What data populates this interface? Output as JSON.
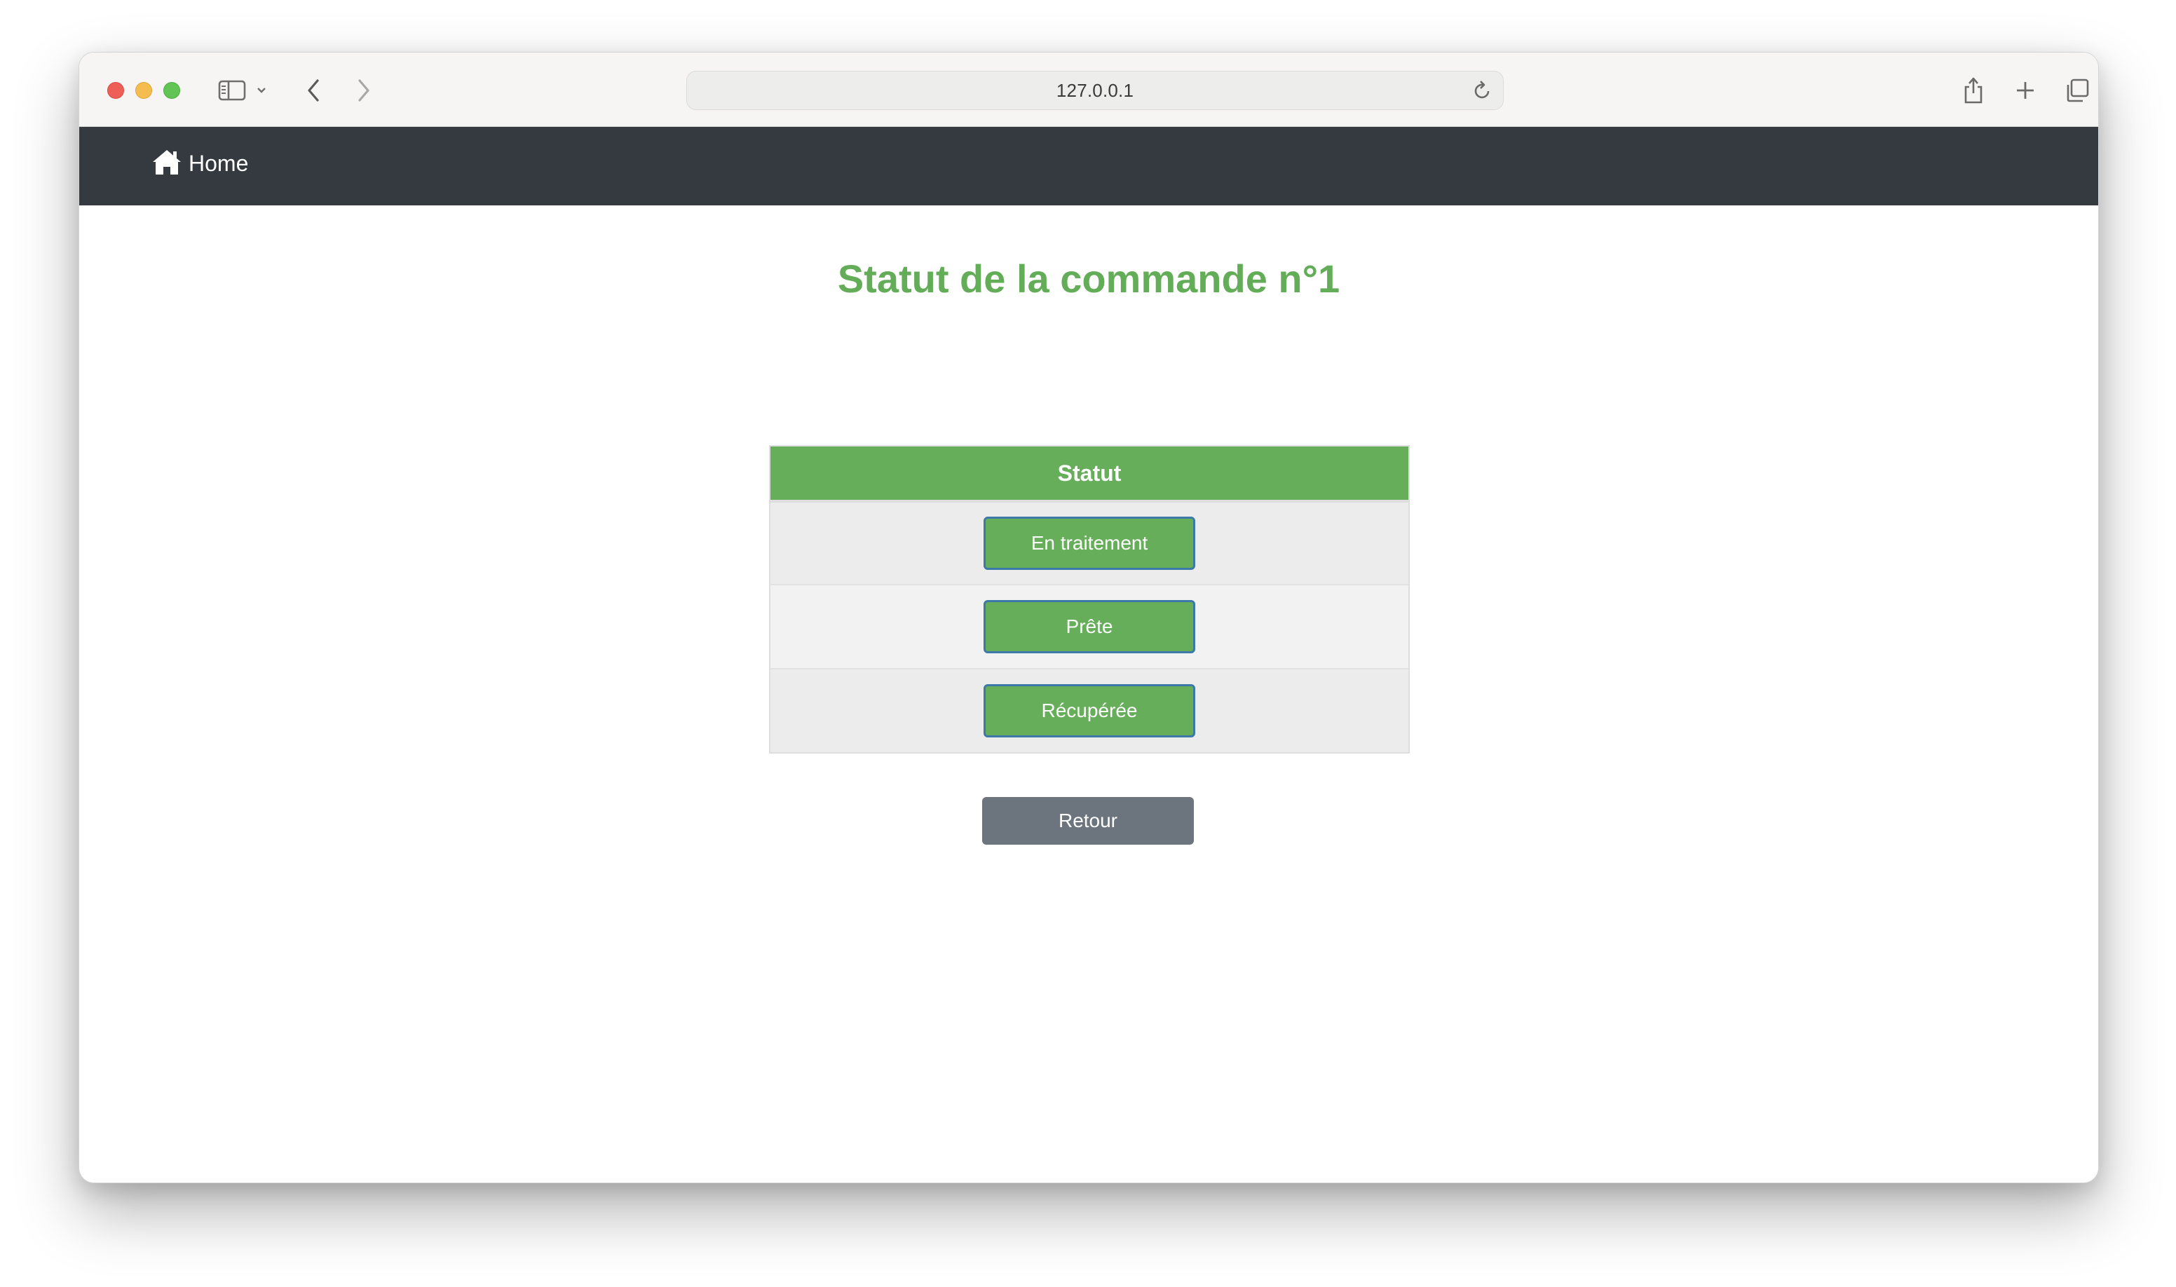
{
  "browser": {
    "url": "127.0.0.1",
    "icons": [
      "sidebar-icon",
      "chevron-down-icon",
      "back-icon",
      "forward-icon",
      "reload-icon",
      "share-icon",
      "new-tab-icon",
      "tabs-overview-icon"
    ]
  },
  "navbar": {
    "brand_label": "Home",
    "brand_icon": "home-icon",
    "background": "#343a40"
  },
  "page": {
    "title": "Statut de la commande n°1",
    "title_color": "#64ad58"
  },
  "status_table": {
    "header": "Statut",
    "header_color": "#67ae5b",
    "options": [
      "En traitement",
      "Prête",
      "Récupérée"
    ]
  },
  "back_button": {
    "label": "Retour",
    "color": "#6c757d"
  }
}
